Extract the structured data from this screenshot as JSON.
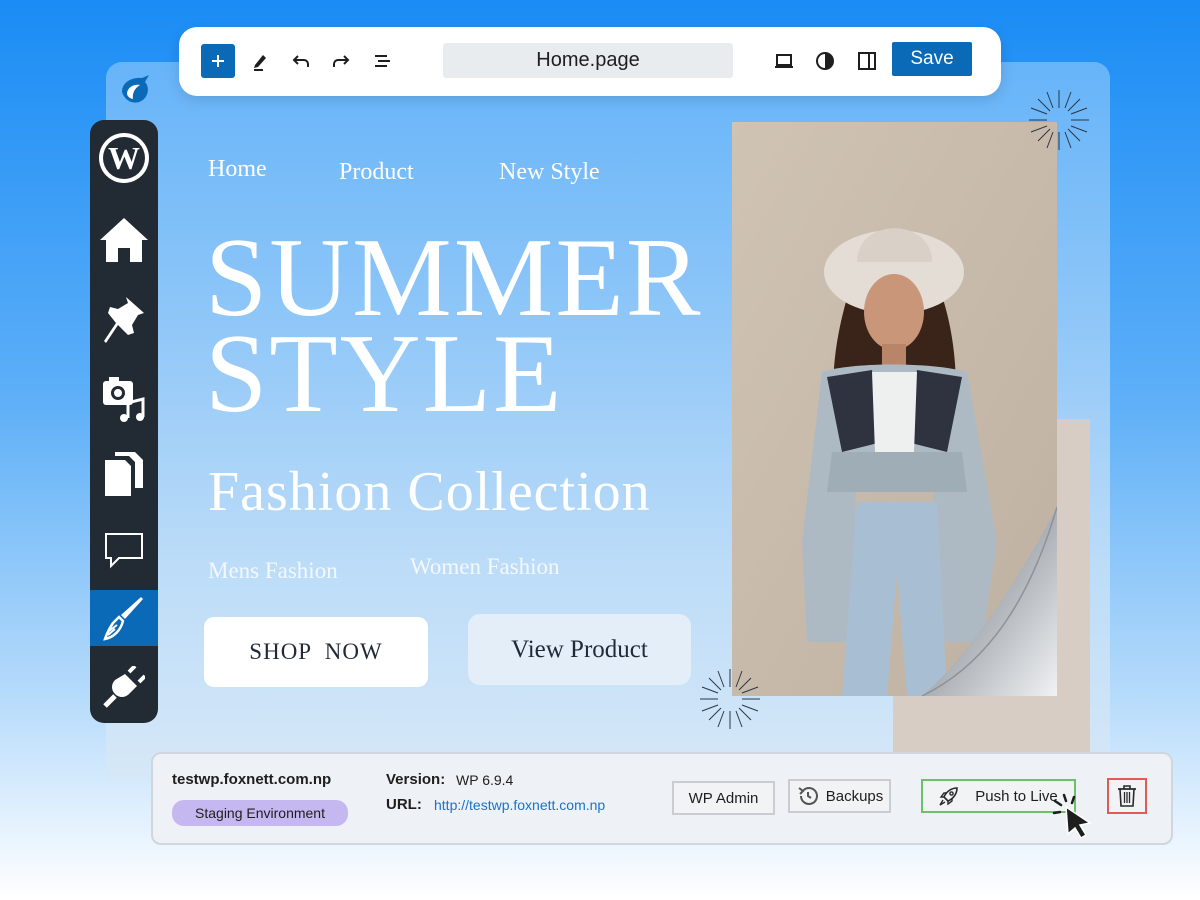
{
  "colors": {
    "accent": "#0b6ab8",
    "sidebar_bg": "#222a33",
    "staging_badge": "#c5b7f0",
    "push_border": "#6cc067",
    "delete_border": "#e05a5a",
    "link": "#1a73c8"
  },
  "toolbar": {
    "icons": [
      "plus-icon",
      "pen-icon",
      "undo-icon",
      "redo-icon",
      "list-view-icon",
      "desktop-preview-icon",
      "contrast-icon",
      "sidebar-toggle-icon"
    ],
    "page_name": "Home.page",
    "save_label": "Save"
  },
  "sidebar": {
    "items": [
      {
        "icon": "wordpress-icon"
      },
      {
        "icon": "home-icon"
      },
      {
        "icon": "pin-icon"
      },
      {
        "icon": "media-icon"
      },
      {
        "icon": "pages-icon"
      },
      {
        "icon": "comment-icon"
      },
      {
        "icon": "appearance-brush-icon",
        "active": true
      },
      {
        "icon": "plugins-icon"
      }
    ]
  },
  "hero": {
    "nav": [
      "Home",
      "Product",
      "New Style"
    ],
    "title_line1": "SUMMER",
    "title_line2": "STYLE",
    "subtitle": "Fashion Collection",
    "categories": [
      "Mens Fashion",
      "Women Fashion"
    ],
    "shop_button": "SHOP  NOW",
    "view_button": "View Product"
  },
  "site": {
    "domain": "testwp.foxnett.com.np",
    "environment": "Staging Environment",
    "version_label": "Version:",
    "version_value": "WP 6.9.4",
    "url_label": "URL:",
    "url_value": "http://testwp.foxnett.com.np"
  },
  "actions": {
    "wp_admin": "WP Admin",
    "backups": "Backups",
    "push_to_live": "Push to Live",
    "delete_icon": "trash-icon"
  }
}
